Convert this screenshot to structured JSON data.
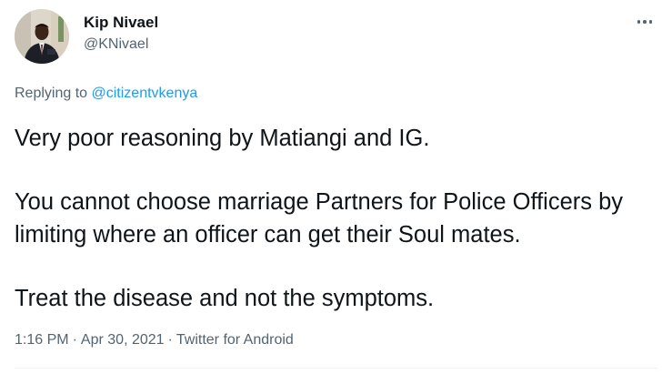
{
  "tweet": {
    "author": {
      "display_name": "Kip Nivael",
      "handle": "@KNivael"
    },
    "reply_context": {
      "prefix": "Replying to ",
      "mention": "@citizentvkenya"
    },
    "text": {
      "line1": "Very poor reasoning by Matiangi and IG.",
      "line2": "You cannot choose marriage Partners for Police Officers by limiting where an officer can get their Soul mates.",
      "line3": "Treat the disease and not the symptoms."
    },
    "meta": {
      "time": "1:16 PM",
      "separator": "·",
      "date": "Apr 30, 2021",
      "source": "Twitter for Android"
    },
    "icons": {
      "more": "more-horizontal-icon"
    },
    "colors": {
      "primary_text": "#0f1419",
      "secondary_text": "#536471",
      "link": "#1d9bf0",
      "divider": "#eff3f4"
    }
  }
}
